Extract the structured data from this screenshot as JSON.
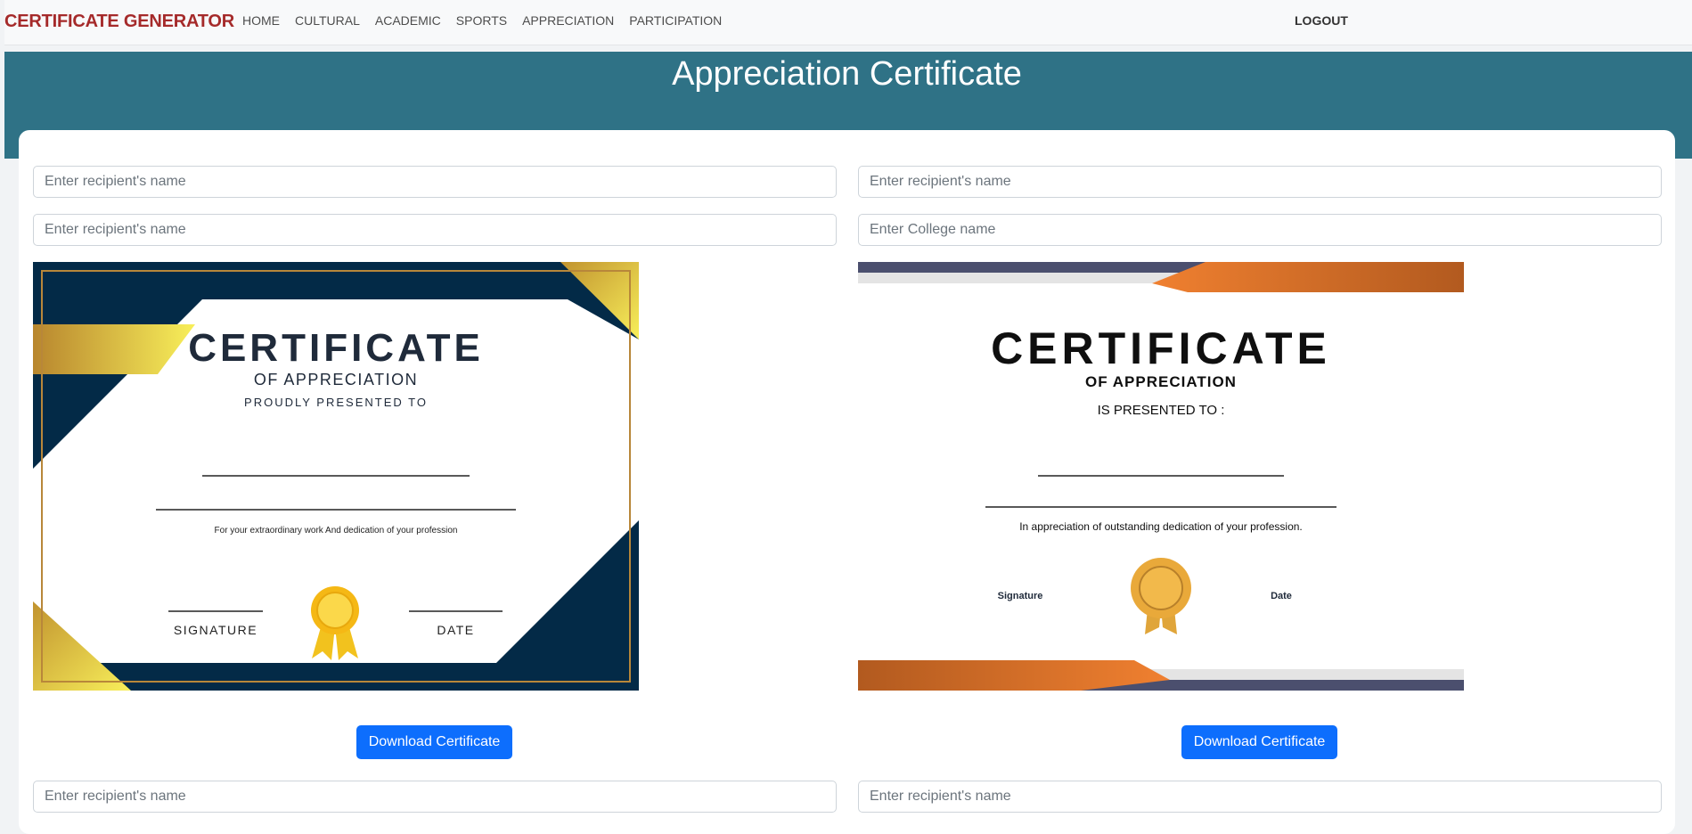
{
  "navbar": {
    "brand": "CERTIFICATE GENERATOR",
    "links": [
      "HOME",
      "CULTURAL",
      "ACADEMIC",
      "SPORTS",
      "APPRECIATION",
      "PARTICIPATION"
    ],
    "logout": "LOGOUT"
  },
  "page": {
    "title": "Appreciation Certificate"
  },
  "forms": {
    "left": {
      "name1_placeholder": "Enter recipient's name",
      "name2_placeholder": "Enter recipient's name",
      "download_label": "Download Certificate",
      "next_placeholder": "Enter recipient's name"
    },
    "right": {
      "name_placeholder": "Enter recipient's name",
      "college_placeholder": "Enter College name",
      "download_label": "Download Certificate",
      "next_placeholder": "Enter recipient's name"
    }
  },
  "cert1": {
    "title": "CERTIFICATE",
    "subtitle": "OF APPRECIATION",
    "presented": "PROUDLY PRESENTED TO",
    "note": "For your extraordinary work And dedication of your profession",
    "signature": "SIGNATURE",
    "date": "DATE",
    "colors": {
      "navy": "#032a47",
      "gold": "#f5d63f",
      "border": "#b8873a"
    },
    "seal_icon": "ribbon-medal-icon"
  },
  "cert2": {
    "title": "CERTIFICATE",
    "subtitle": "OF APPRECIATION",
    "presented": "IS PRESENTED TO :",
    "note": "In appreciation of outstanding dedication of your profession.",
    "signature": "Signature",
    "date": "Date",
    "colors": {
      "orange": "#e7772b",
      "slate": "#4b4f6e",
      "gold": "#e0a53a"
    },
    "seal_icon": "gold-seal-icon"
  },
  "colors": {
    "banner": "#2f7286",
    "brand": "#a52a2a",
    "button": "#0d6efd"
  }
}
